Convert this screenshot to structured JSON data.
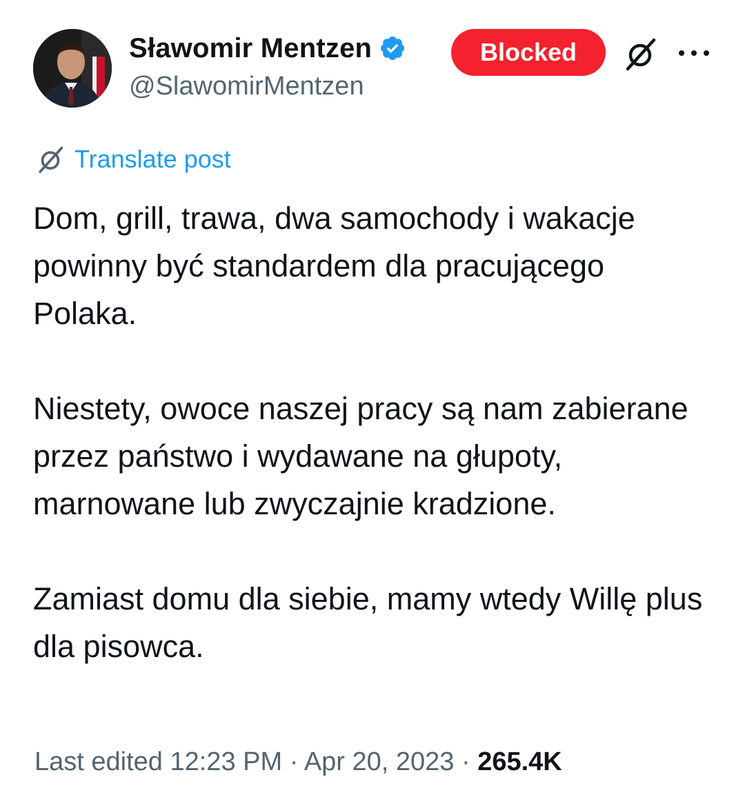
{
  "author": {
    "display_name": "Sławomir Mentzen",
    "handle": "@SlawomirMentzen",
    "verified": true
  },
  "actions": {
    "blocked_label": "Blocked",
    "grok_icon": "grok-icon",
    "more_icon": "more-icon"
  },
  "translate": {
    "label": "Translate post",
    "icon": "grok-icon"
  },
  "post": {
    "paragraphs": [
      "Dom, grill, trawa, dwa samochody i wakacje powinny być standardem dla pracującego Polaka.",
      "Niestety, owoce naszej pracy są nam zabierane przez państwo i wydawane na głupoty, marnowane lub zwyczajnie kradzione.",
      "Zamiast domu dla siebie, mamy wtedy Willę plus dla pisowca."
    ]
  },
  "meta": {
    "edited_prefix": "Last edited",
    "time": "12:23 PM",
    "separator": "·",
    "date": "Apr 20, 2023",
    "views": "265.4K"
  },
  "colors": {
    "blocked_bg": "#f4212e",
    "link_blue": "#1d9bf0",
    "secondary_text": "#536471",
    "primary_text": "#0f1419",
    "verified_blue": "#1d9bf0"
  }
}
